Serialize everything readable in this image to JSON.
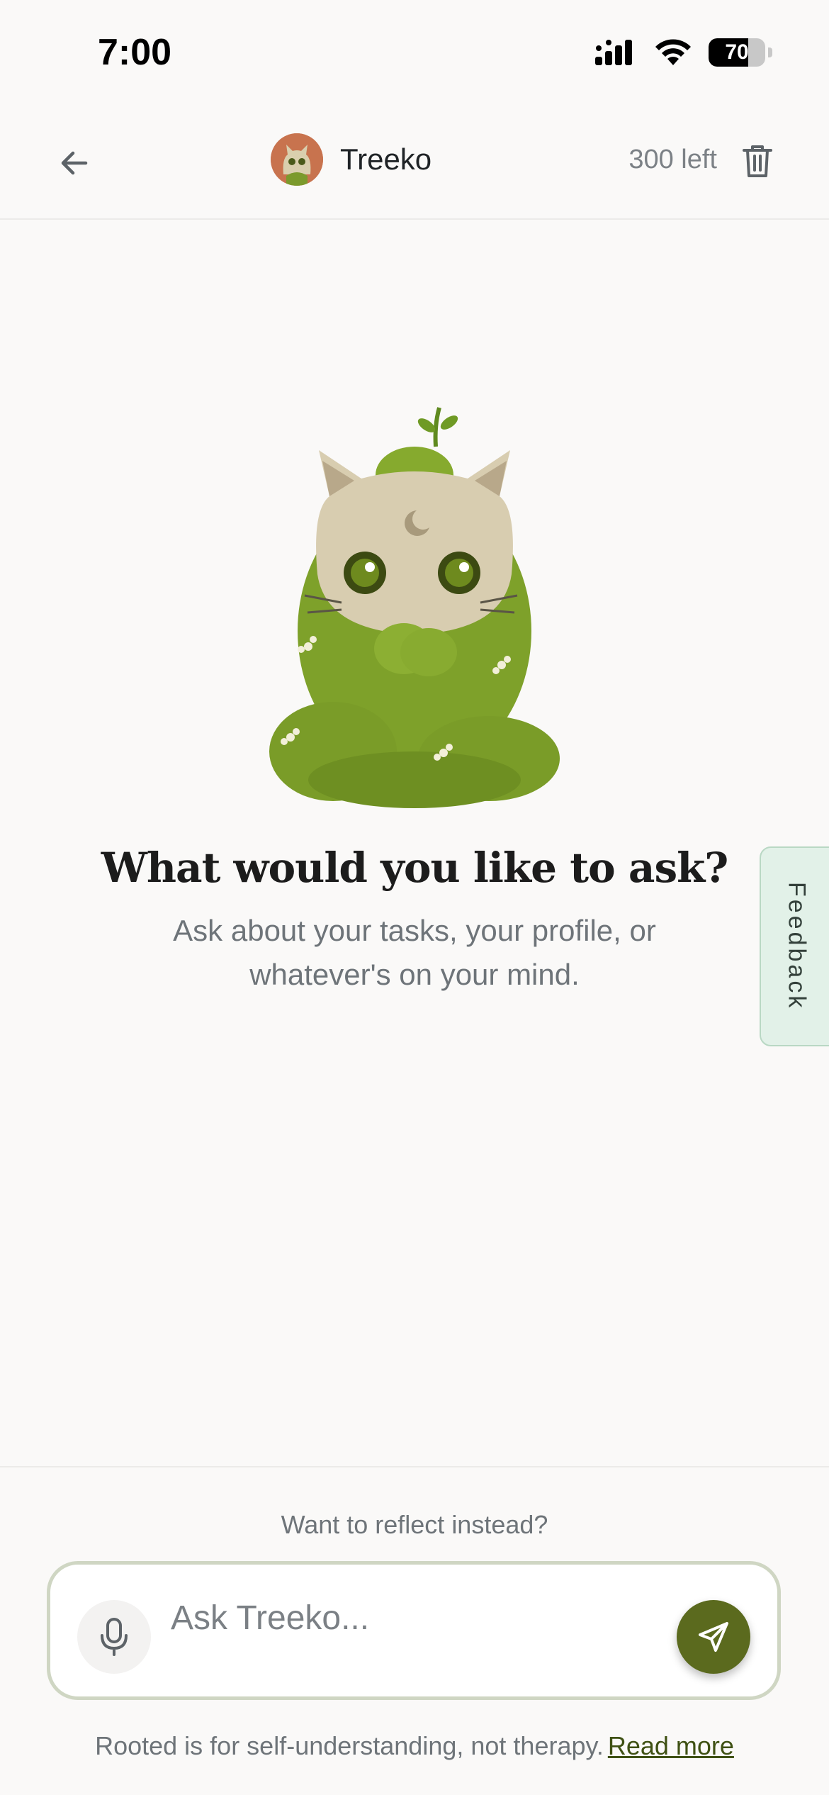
{
  "status_bar": {
    "time": "7:00",
    "battery_level": "70",
    "battery_fraction": 0.7,
    "icons": [
      "cellular-signal-icon",
      "wifi-icon",
      "battery-icon"
    ]
  },
  "header": {
    "back_icon": "arrow-left-icon",
    "title": "Treeko",
    "remaining": "300 left",
    "trash_icon": "trash-icon"
  },
  "main": {
    "mascot": "moss-cat-mascot",
    "title": "What would you like to ask?",
    "subtitle": "Ask about your tasks, your profile, or whatever's on your mind."
  },
  "feedback": {
    "label": "Feedback"
  },
  "composer": {
    "reflect_link": "Want to reflect instead?",
    "placeholder": "Ask Treeko...",
    "mic_icon": "microphone-icon",
    "send_icon": "send-icon"
  },
  "footer": {
    "disclaimer": "Rooted is for self-understanding, not therapy.",
    "read_more": "Read more"
  },
  "colors": {
    "accent": "#5b6a1e",
    "feedback_bg": "#e2f1e8",
    "background": "#faf9f8",
    "input_border": "#cfd6c3"
  }
}
